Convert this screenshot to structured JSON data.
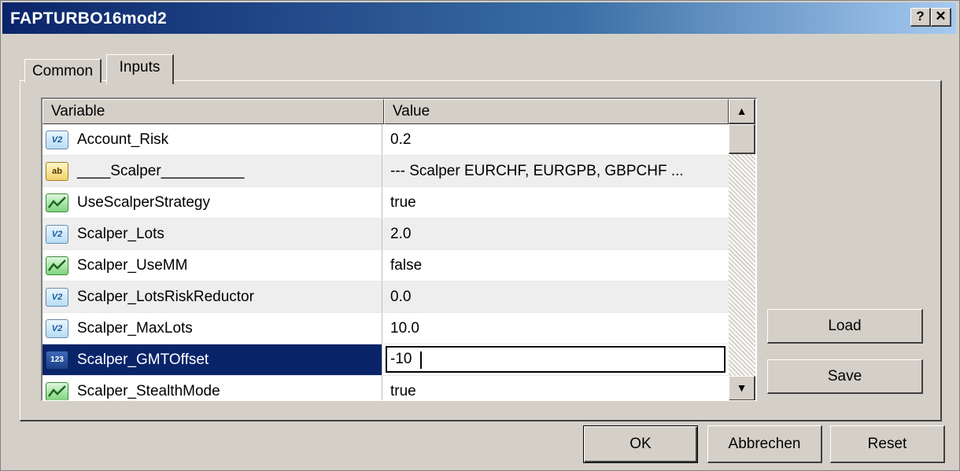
{
  "window": {
    "title": "FAPTURBO16mod2",
    "help_label": "?",
    "close_label": "✕"
  },
  "tabs": [
    {
      "label": "Common"
    },
    {
      "label": "Inputs"
    }
  ],
  "table": {
    "columns": [
      "Variable",
      "Value"
    ],
    "rows": [
      {
        "icon": "double-icon",
        "variable": "Account_Risk",
        "value": "0.2"
      },
      {
        "icon": "string-icon",
        "variable": "____Scalper__________",
        "value": "--- Scalper EURCHF, EURGPB, GBPCHF ..."
      },
      {
        "icon": "bool-icon",
        "variable": "UseScalperStrategy",
        "value": "true"
      },
      {
        "icon": "double-icon",
        "variable": "Scalper_Lots",
        "value": "2.0"
      },
      {
        "icon": "bool-icon",
        "variable": "Scalper_UseMM",
        "value": "false"
      },
      {
        "icon": "double-icon",
        "variable": "Scalper_LotsRiskReductor",
        "value": "0.0"
      },
      {
        "icon": "double-icon",
        "variable": "Scalper_MaxLots",
        "value": "10.0"
      },
      {
        "icon": "int-icon",
        "variable": "Scalper_GMTOffset",
        "value": "-10"
      },
      {
        "icon": "bool-icon",
        "variable": "Scalper_StealthMode",
        "value": "true"
      }
    ],
    "icon_texts": {
      "double": "V2",
      "string": "ab",
      "int": "123"
    }
  },
  "scrollbar": {
    "up_arrow": "▲",
    "down_arrow": "▼"
  },
  "side_buttons": {
    "load": "Load",
    "save": "Save"
  },
  "footer_buttons": {
    "ok": "OK",
    "cancel": "Abbrechen",
    "reset": "Reset"
  }
}
